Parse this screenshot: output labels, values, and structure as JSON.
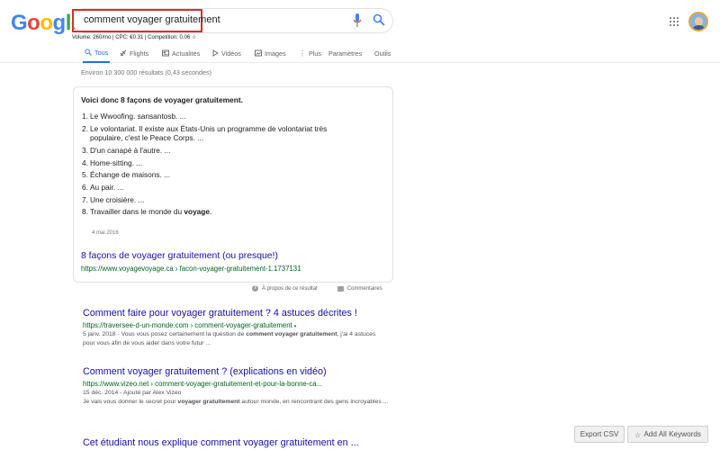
{
  "logo": {
    "letters": [
      "G",
      "o",
      "o",
      "g",
      "l",
      "e"
    ],
    "colors": [
      "#4285f4",
      "#ea4335",
      "#fbbc05",
      "#4285f4",
      "#34a853",
      "#ea4335"
    ]
  },
  "search": {
    "value": "comment voyager gratuitement"
  },
  "keyword_stats": "Volume: 260/mo | CPC: €0.31 | Competition: 0.06 ☆",
  "tabs": [
    {
      "label": "Tous",
      "icon": "search-icon"
    },
    {
      "label": "Flights",
      "icon": "plane-icon"
    },
    {
      "label": "Actualités",
      "icon": "news-icon"
    },
    {
      "label": "Vidéos",
      "icon": "video-icon"
    },
    {
      "label": "Images",
      "icon": "image-icon"
    },
    {
      "label": "Plus",
      "icon": "more-icon"
    },
    {
      "label": "Paramètres",
      "icon": ""
    },
    {
      "label": "Outils",
      "icon": ""
    }
  ],
  "result_stats": "Environ 10 300 000 résultats (0,43 secondes)",
  "snippet": {
    "heading": "Voici donc 8 façons de voyager gratuitement.",
    "items": [
      {
        "num": "1.",
        "text": "Le Wwoofing. sansantosb. ..."
      },
      {
        "num": "2.",
        "text": "Le volontariat. Il existe aux États-Unis un programme de volontariat très populaire, c'est le Peace Corps. ..."
      },
      {
        "num": "3.",
        "text": "D'un canapé à l'autre. ..."
      },
      {
        "num": "4.",
        "text": "Home-sitting. ..."
      },
      {
        "num": "5.",
        "text": "Échange de maisons. ..."
      },
      {
        "num": "6.",
        "text": "Au pair. ..."
      },
      {
        "num": "7.",
        "text": "Une croisière. ..."
      },
      {
        "num": "8.",
        "text": "Travailler dans le monde du ",
        "bold": "voyage",
        "after": "."
      }
    ],
    "date": "4 mai 2016",
    "link_title": "8 façons de voyager gratuitement (ou presque!)",
    "link_url": "https://www.voyagevoyage.ca › facon-voyager-gratuitement-1.1737131",
    "footer_about": "À propos de ce résultat",
    "footer_comments": "Commentaires"
  },
  "results": [
    {
      "title": "Comment faire pour voyager gratuitement ? 4 astuces décrites !",
      "url": "https://traversee-d-un-monde.com › comment-voyager-gratuitement",
      "caret": "▾",
      "desc_pre": "5 janv. 2018 - Vous vous posez certainement la question de ",
      "desc_bold": "comment voyager gratuitement",
      "desc_post": ", j'ai 4 astuces pour vous afin de vous aider dans votre futur ..."
    },
    {
      "title": "Comment voyager gratuitement ? (explications en vidéo)",
      "url": "https://www.vizeo.net › comment-voyager-gratuitement-et-pour-la-bonne-ca...",
      "meta": "15 déc. 2014 - Ajouté par Alex Vizeo",
      "desc_pre": "Je vais vous donner le secret pour ",
      "desc_bold": "voyager gratuitement",
      "desc_post": " autour monde, en rencontrant des gens incroyables ..."
    },
    {
      "title": "Cet étudiant nous explique comment voyager gratuitement en ..."
    }
  ],
  "buttons": {
    "export": "Export CSV",
    "add_all": "Add All Keywords",
    "star": "☆"
  }
}
